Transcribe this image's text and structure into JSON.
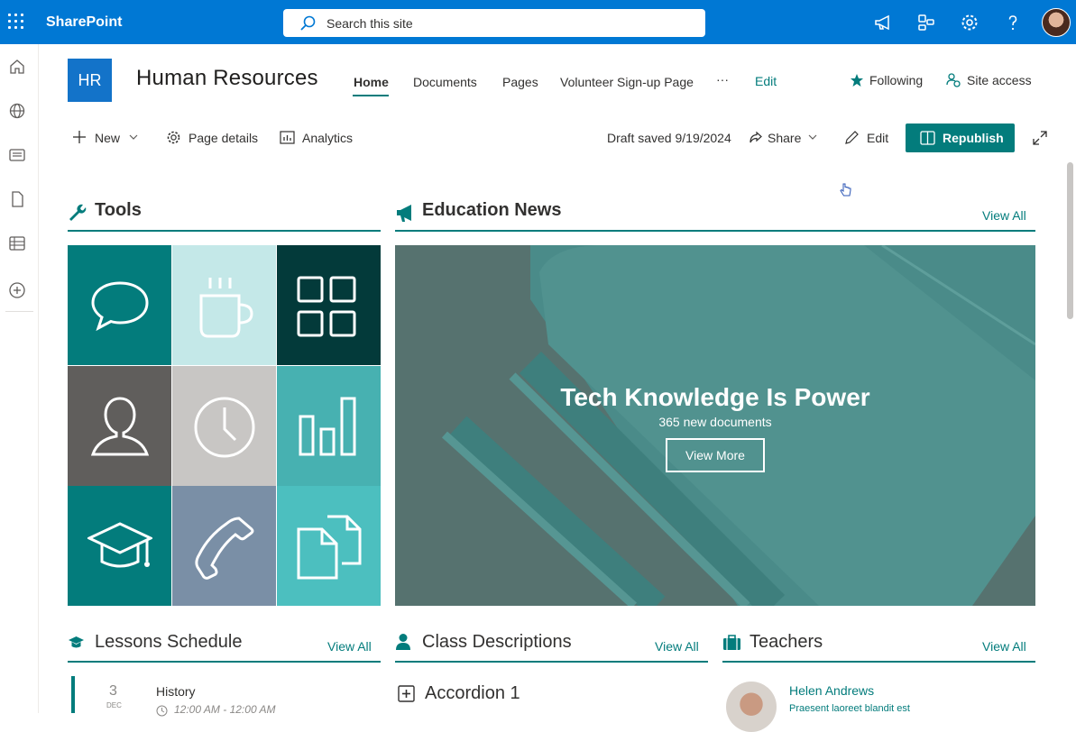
{
  "suite": {
    "brand": "SharePoint",
    "search_placeholder": "Search this site"
  },
  "site": {
    "logo_text": "HR",
    "title": "Human Resources",
    "nav": [
      "Home",
      "Documents",
      "Pages",
      "Volunteer Sign-up Page",
      "···",
      "Edit"
    ],
    "following_label": "Following",
    "site_access_label": "Site access"
  },
  "commandbar": {
    "new_label": "New",
    "page_details_label": "Page details",
    "analytics_label": "Analytics",
    "draft_status": "Draft saved 9/19/2024",
    "share_label": "Share",
    "edit_label": "Edit",
    "republish_label": "Republish"
  },
  "tools": {
    "title": "Tools",
    "tiles": [
      {
        "icon": "chat-icon",
        "color": "#037c7c"
      },
      {
        "icon": "coffee-icon",
        "color": "#c4e8e8"
      },
      {
        "icon": "apps-grid-icon",
        "color": "#033a3a"
      },
      {
        "icon": "person-icon",
        "color": "#605e5c"
      },
      {
        "icon": "clock-icon",
        "color": "#c8c6c4"
      },
      {
        "icon": "bar-chart-icon",
        "color": "#47b1b1"
      },
      {
        "icon": "graduation-cap-icon",
        "color": "#037c7c"
      },
      {
        "icon": "phone-icon",
        "color": "#7a8fa6"
      },
      {
        "icon": "documents-icon",
        "color": "#4cbfbf"
      }
    ]
  },
  "news": {
    "title": "Education News",
    "view_all": "View All",
    "hero_title": "Tech Knowledge Is Power",
    "hero_subtitle": "365 new documents",
    "hero_button": "View More"
  },
  "lessons": {
    "title": "Lessons Schedule",
    "view_all": "View All",
    "items": [
      {
        "day": "3",
        "month": "DEC",
        "name": "History",
        "time": "12:00 AM - 12:00 AM"
      }
    ]
  },
  "classes": {
    "title": "Class Descriptions",
    "view_all": "View All",
    "accordion_label": "Accordion 1"
  },
  "teachers": {
    "title": "Teachers",
    "view_all": "View All",
    "items": [
      {
        "name": "Helen Andrews",
        "desc": "Praesent laoreet blandit est"
      }
    ]
  },
  "colors": {
    "suite_blue": "#0078d4",
    "accent_teal": "#037c7c"
  }
}
